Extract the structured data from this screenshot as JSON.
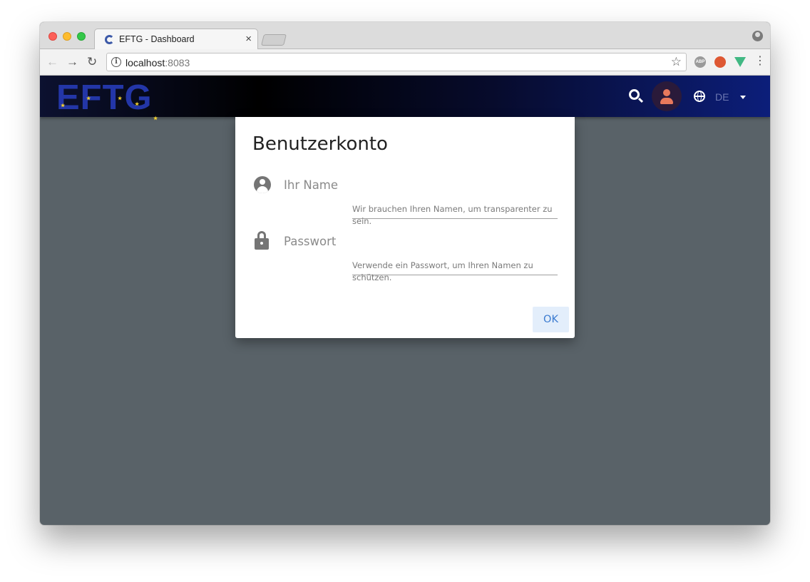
{
  "browser": {
    "tab_title": "EFTG - Dashboard",
    "tab_close": "×",
    "url_host": "localhost",
    "url_port": ":8083",
    "icons": {
      "back": "arrow-left-icon",
      "forward": "arrow-right-icon",
      "reload": "reload-icon",
      "bookmark": "star-icon",
      "menu": "more-vert-icon"
    },
    "extensions": [
      "adblock-icon",
      "duckduckgo-icon",
      "vue-devtools-icon"
    ],
    "abp_label": "ABP"
  },
  "appbar": {
    "logo_text": "EFTG",
    "language": "DE",
    "colors": {
      "logo": "#2336a8",
      "avatar": "#e8795c"
    }
  },
  "dialog": {
    "title": "Benutzerkonto",
    "name_field": {
      "label": "Ihr Name",
      "value": "",
      "hint": "Wir brauchen Ihren Namen, um transparenter zu sein."
    },
    "password_field": {
      "label": "Passwort",
      "value": "",
      "hint": "Verwende ein Passwort, um Ihren Namen zu schützen."
    },
    "ok_label": "OK"
  }
}
